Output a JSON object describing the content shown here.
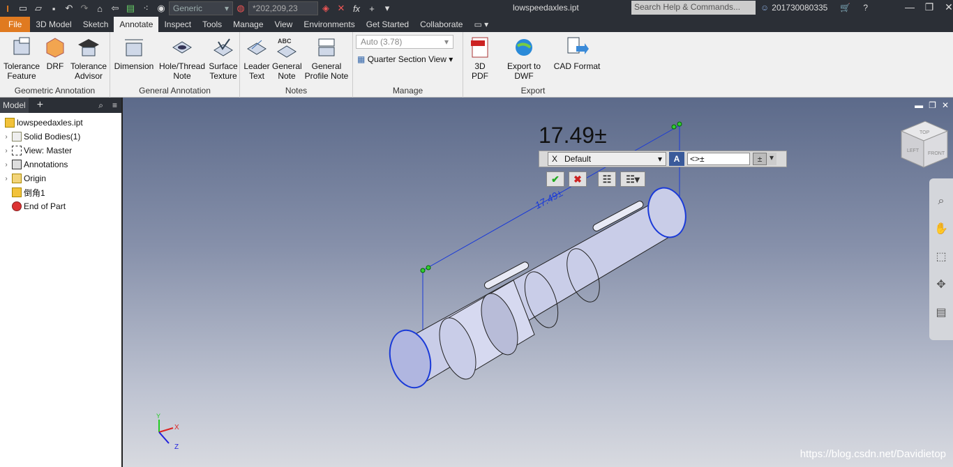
{
  "titlebar": {
    "material": "Generic",
    "color_override": "*202,209,23",
    "app_title": "lowspeedaxles.ipt",
    "search_placeholder": "Search Help & Commands...",
    "user": "201730080335"
  },
  "tabs": [
    "File",
    "3D Model",
    "Sketch",
    "Annotate",
    "Inspect",
    "Tools",
    "Manage",
    "View",
    "Environments",
    "Get Started",
    "Collaborate"
  ],
  "active_tab": "Annotate",
  "ribbon": {
    "geometric": {
      "label": "Geometric Annotation",
      "buttons": [
        "Tolerance\nFeature",
        "DRF",
        "Tolerance\nAdvisor"
      ]
    },
    "general": {
      "label": "General Annotation",
      "buttons": [
        "Dimension",
        "Hole/Thread\nNote",
        "Surface\nTexture"
      ]
    },
    "notes": {
      "label": "Notes",
      "buttons": [
        "Leader\nText",
        "General\nNote",
        "General\nProfile Note"
      ]
    },
    "manage": {
      "label": "Manage",
      "combo": "Auto (3.78)",
      "section_view": "Quarter Section View"
    },
    "export": {
      "label": "Export",
      "buttons": [
        "3D PDF",
        "Export to DWF",
        "CAD Format"
      ]
    }
  },
  "browser": {
    "tab": "Model",
    "items": [
      {
        "label": "lowspeedaxles.ipt",
        "level": 0
      },
      {
        "label": "Solid Bodies(1)",
        "level": 1
      },
      {
        "label": "View: Master",
        "level": 1
      },
      {
        "label": "Annotations",
        "level": 1
      },
      {
        "label": "Origin",
        "level": 1
      },
      {
        "label": "倒角1",
        "level": 1
      },
      {
        "label": "End of Part",
        "level": 1
      }
    ]
  },
  "viewport": {
    "dimension_text": "17.49±",
    "dimension_label": "17.49±",
    "style": "Default",
    "edit_prefix": "X",
    "edit_value": "<>±",
    "watermark": "https://blog.csdn.net/Davidietop",
    "viewcube_left": "LEFT",
    "viewcube_front": "FRONT",
    "viewcube_top": "TOP",
    "axes": {
      "x": "X",
      "y": "Y",
      "z": "Z"
    }
  }
}
